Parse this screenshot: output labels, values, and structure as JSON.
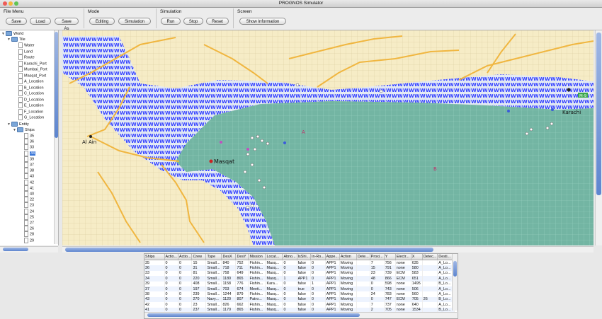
{
  "window": {
    "title": "PROGNOS Simulator"
  },
  "toolbar": {
    "groups": [
      {
        "title": "File Menu",
        "buttons": [
          "Save",
          "Load",
          "Save As"
        ]
      },
      {
        "title": "Mode",
        "buttons": [
          "Editing",
          "Simulation"
        ]
      },
      {
        "title": "Simulation",
        "buttons": [
          "Run",
          "Stop",
          "Reset"
        ]
      },
      {
        "title": "Screen",
        "buttons": [
          "Show Information"
        ]
      }
    ]
  },
  "tree": {
    "root": "World",
    "tile_label": "Tile",
    "tile_children": [
      "Water",
      "Land",
      "Route",
      "Karachi_Port",
      "Mumbai_Port",
      "Masqat_Port",
      "A_Location",
      "B_Location",
      "C_Location",
      "D_Location",
      "E_Location",
      "F_Location",
      "G_Location"
    ],
    "entity_label": "Entity",
    "ships_label": "Ships",
    "ships": [
      "35",
      "36",
      "33",
      "34",
      "39",
      "37",
      "38",
      "43",
      "42",
      "41",
      "40",
      "22",
      "23",
      "24",
      "25",
      "27",
      "26",
      "28",
      "29"
    ],
    "selected_ship": "34"
  },
  "map": {
    "labels": [
      {
        "text": "Masqat"
      },
      {
        "text": "Karachi"
      },
      {
        "text": "Al Ain"
      },
      {
        "text": "A"
      },
      {
        "text": "B"
      },
      {
        "text": "M-9"
      }
    ]
  },
  "table": {
    "columns": [
      "Ships",
      "Actio...",
      "Actio...",
      "Crew",
      "Type",
      "DesX",
      "DesY",
      "Mission",
      "Locat...",
      "Abno...",
      "IsShi...",
      "In-Ro...",
      "Appe...",
      "Action",
      "Dete...",
      "Proxi...",
      "Y",
      "Electr...",
      "X",
      "Detec...",
      "Desti..."
    ],
    "rows": [
      [
        "35",
        "0",
        "0",
        "15",
        "Small...",
        "840",
        "752",
        "Fishin...",
        "Masq...",
        "0",
        "false",
        "0",
        "APP1",
        "Moving",
        "",
        "7",
        "756",
        "none",
        "635",
        "",
        "A_Lo..."
      ],
      [
        "36",
        "0",
        "0",
        "31",
        "Small...",
        "718",
        "711",
        "Fishin...",
        "Masq...",
        "0",
        "false",
        "0",
        "APP1",
        "Moving",
        "",
        "15",
        "791",
        "none",
        "580",
        "",
        "A_Lo..."
      ],
      [
        "33",
        "0",
        "0",
        "81",
        "Small...",
        "758",
        "649",
        "Fishin...",
        "Masq...",
        "0",
        "false",
        "0",
        "APP1",
        "Moving",
        "",
        "23",
        "739",
        "ECM",
        "583",
        "",
        "A_Lo..."
      ],
      [
        "34",
        "0",
        "0",
        "220",
        "Small...",
        "1180",
        "865",
        "Fishin...",
        "Masq...",
        "1",
        "APP1",
        "0",
        "APP1",
        "Moving",
        "",
        "48",
        "866",
        "ECM",
        "651",
        "",
        "A_Lo..."
      ],
      [
        "39",
        "0",
        "0",
        "408",
        "Small...",
        "1158",
        "776",
        "Fishin...",
        "Kara...",
        "0",
        "false",
        "1",
        "APP1",
        "Moving",
        "",
        "0",
        "598",
        "none",
        "1495",
        "",
        "B_Lo..."
      ],
      [
        "37",
        "0",
        "0",
        "197",
        "Small...",
        "703",
        "674",
        "Meeti...",
        "Masq...",
        "0",
        "true",
        "0",
        "APP1",
        "Moving",
        "",
        "0",
        "743",
        "none",
        "506",
        "",
        "A_Lo..."
      ],
      [
        "38",
        "0",
        "0",
        "239",
        "Small...",
        "1244",
        "879",
        "Fishin...",
        "Masq...",
        "0",
        "false",
        "0",
        "APP1",
        "Moving",
        "",
        "24",
        "783",
        "none",
        "560",
        "",
        "A_Lo..."
      ],
      [
        "43",
        "0",
        "0",
        "270",
        "Navy...",
        "1120",
        "807",
        "Patro...",
        "Masq...",
        "0",
        "false",
        "0",
        "APP1",
        "Moving",
        "",
        "0",
        "747",
        "ECM",
        "705",
        "26",
        "B_Lo..."
      ],
      [
        "42",
        "0",
        "0",
        "23",
        "Small...",
        "826",
        "662",
        "Fishin...",
        "Masq...",
        "0",
        "false",
        "0",
        "APP1",
        "Moving",
        "",
        "7",
        "737",
        "none",
        "640",
        "",
        "A_Lo..."
      ],
      [
        "41",
        "0",
        "0",
        "237",
        "Small...",
        "1170",
        "865",
        "Fishin...",
        "Masq...",
        "0",
        "false",
        "0",
        "APP1",
        "Moving",
        "",
        "2",
        "705",
        "none",
        "1534",
        "",
        "B_Lo..."
      ],
      [
        "40",
        "0",
        "0",
        "384",
        "Small...",
        "759",
        "705",
        "Meeti...",
        "Kara...",
        "0",
        "true",
        "0",
        "APP1",
        "Moving",
        "",
        "24",
        "768",
        "none",
        "589",
        "",
        "A_Lo..."
      ]
    ]
  },
  "colors": {
    "land": "#f6ecc6",
    "water": "#73b5a3",
    "route_water": "#2f3cff",
    "road": "#f0b640",
    "selection": "#3875d7"
  }
}
